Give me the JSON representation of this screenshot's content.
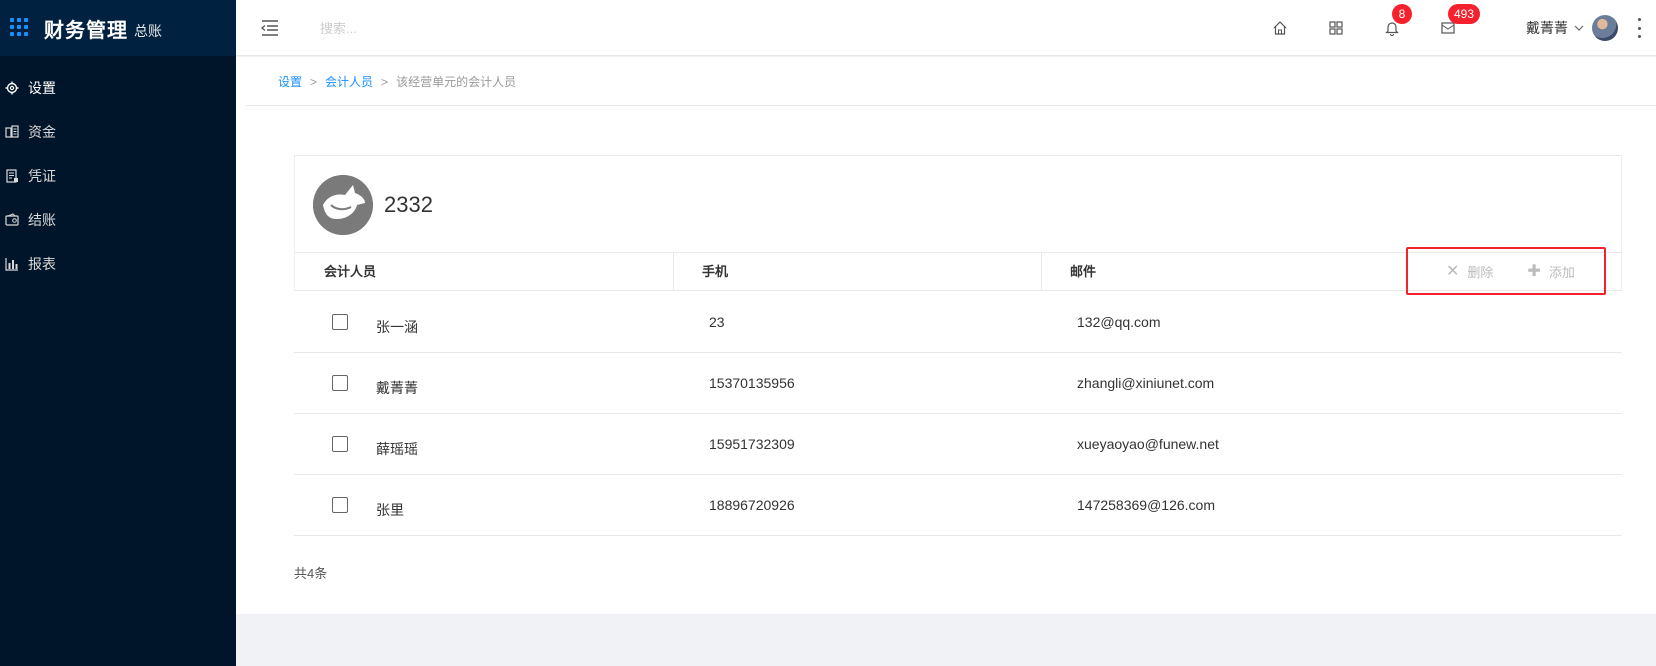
{
  "brand": {
    "title": "财务管理",
    "subtitle": "总账"
  },
  "sidebar": {
    "items": [
      {
        "label": "设置",
        "icon": "gear-icon"
      },
      {
        "label": "资金",
        "icon": "funds-icon"
      },
      {
        "label": "凭证",
        "icon": "voucher-icon"
      },
      {
        "label": "结账",
        "icon": "wallet-icon"
      },
      {
        "label": "报表",
        "icon": "bar-chart-icon"
      }
    ]
  },
  "header": {
    "search_placeholder": "搜索...",
    "notifications_count": "8",
    "messages_count": "493",
    "username": "戴菁菁"
  },
  "breadcrumb": {
    "level1": "设置",
    "level2": "会计人员",
    "current": "该经营单元的会计人员"
  },
  "unit": {
    "name": "2332"
  },
  "table": {
    "columns": {
      "name": "会计人员",
      "phone": "手机",
      "email": "邮件"
    },
    "actions": {
      "delete": "删除",
      "add": "添加"
    },
    "rows": [
      {
        "name": "张一涵",
        "phone": "23",
        "email": "132@qq.com"
      },
      {
        "name": "戴菁菁",
        "phone": "15370135956",
        "email": "zhangli@xiniunet.com"
      },
      {
        "name": "薛瑶瑶",
        "phone": "15951732309",
        "email": "xueyaoyao@funew.net"
      },
      {
        "name": "张里",
        "phone": "18896720926",
        "email": "147258369@126.com"
      }
    ],
    "total": "共4条"
  },
  "colors": {
    "sidebar_bg": "#001529",
    "accent": "#1890ff",
    "badge": "#f5222d"
  }
}
